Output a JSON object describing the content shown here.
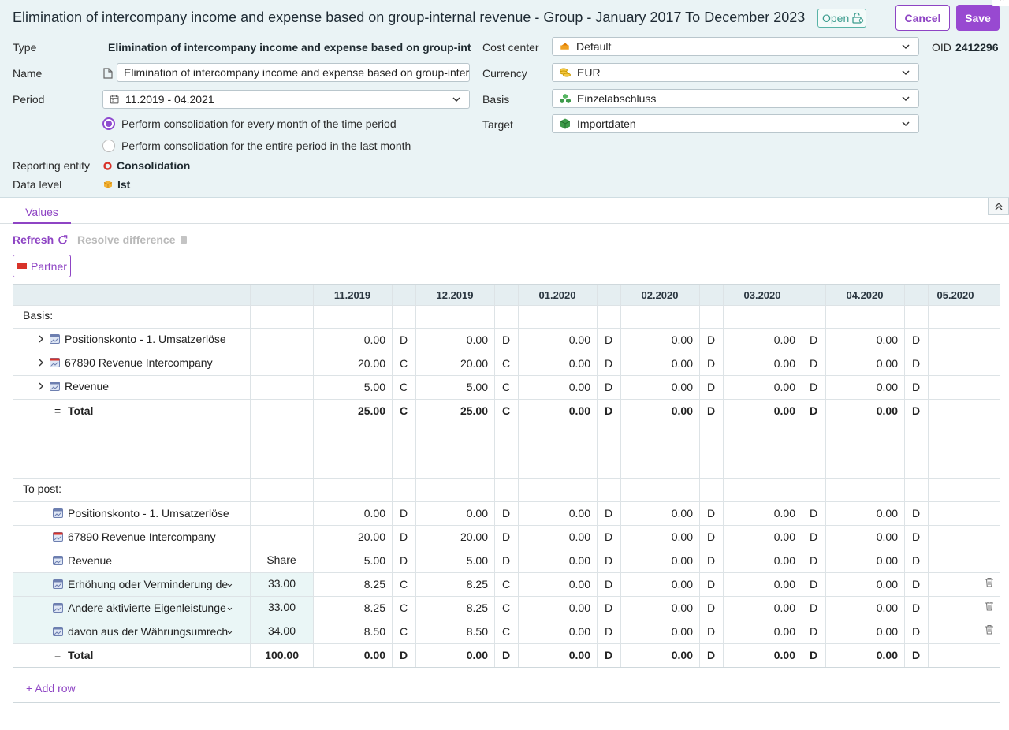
{
  "header": {
    "title": "Elimination of intercompany income and expense based on group-internal revenue - Group - January 2017 To December 2023",
    "status": "Open",
    "cancel_label": "Cancel",
    "save_label": "Save",
    "oid_label": "OID",
    "oid_value": "2412296"
  },
  "form": {
    "type_label": "Type",
    "type_value": "Elimination of intercompany income and expense based on group-inte...",
    "name_label": "Name",
    "name_value": "Elimination of intercompany income and expense based on group-internal revenue",
    "period_label": "Period",
    "period_value": "11.2019 - 04.2021",
    "radio_every_month": "Perform consolidation for every month of the time period",
    "radio_entire_period": "Perform consolidation for the entire period in the last month",
    "radio_selected": "every_month",
    "reporting_entity_label": "Reporting entity",
    "reporting_entity_value": "Consolidation",
    "data_level_label": "Data level",
    "data_level_value": "Ist",
    "cost_center_label": "Cost center",
    "cost_center_value": "Default",
    "currency_label": "Currency",
    "currency_value": "EUR",
    "basis_label": "Basis",
    "basis_value": "Einzelabschluss",
    "target_label": "Target",
    "target_value": "Importdaten"
  },
  "tabs": {
    "values_label": "Values"
  },
  "toolbar": {
    "refresh_label": "Refresh",
    "resolve_label": "Resolve difference",
    "partner_label": "Partner"
  },
  "grid": {
    "periods": [
      "11.2019",
      "12.2019",
      "01.2020",
      "02.2020",
      "03.2020",
      "04.2020",
      "05.2020"
    ],
    "basis_section": "Basis:",
    "topost_section": "To post:",
    "share_header": "Share",
    "basis_rows": [
      {
        "name": "Positionskonto - 1. Umsatzerlöse",
        "icon": "account-icon",
        "cells": [
          [
            "0.00",
            "D"
          ],
          [
            "0.00",
            "D"
          ],
          [
            "0.00",
            "D"
          ],
          [
            "0.00",
            "D"
          ],
          [
            "0.00",
            "D"
          ],
          [
            "0.00",
            "D"
          ]
        ]
      },
      {
        "name": "67890 Revenue Intercompany",
        "icon": "account-ic-icon",
        "cells": [
          [
            "20.00",
            "C"
          ],
          [
            "20.00",
            "C"
          ],
          [
            "0.00",
            "D"
          ],
          [
            "0.00",
            "D"
          ],
          [
            "0.00",
            "D"
          ],
          [
            "0.00",
            "D"
          ]
        ]
      },
      {
        "name": "Revenue",
        "icon": "account-icon",
        "cells": [
          [
            "5.00",
            "C"
          ],
          [
            "5.00",
            "C"
          ],
          [
            "0.00",
            "D"
          ],
          [
            "0.00",
            "D"
          ],
          [
            "0.00",
            "D"
          ],
          [
            "0.00",
            "D"
          ]
        ]
      }
    ],
    "basis_total": {
      "label": "Total",
      "cells": [
        [
          "25.00",
          "C"
        ],
        [
          "25.00",
          "C"
        ],
        [
          "0.00",
          "D"
        ],
        [
          "0.00",
          "D"
        ],
        [
          "0.00",
          "D"
        ],
        [
          "0.00",
          "D"
        ]
      ]
    },
    "topost_rows": [
      {
        "name": "Positionskonto - 1. Umsatzerlöse",
        "icon": "account-icon",
        "share": "",
        "cells": [
          [
            "0.00",
            "D"
          ],
          [
            "0.00",
            "D"
          ],
          [
            "0.00",
            "D"
          ],
          [
            "0.00",
            "D"
          ],
          [
            "0.00",
            "D"
          ],
          [
            "0.00",
            "D"
          ]
        ]
      },
      {
        "name": "67890 Revenue Intercompany",
        "icon": "account-ic-icon",
        "share": "",
        "cells": [
          [
            "20.00",
            "D"
          ],
          [
            "20.00",
            "D"
          ],
          [
            "0.00",
            "D"
          ],
          [
            "0.00",
            "D"
          ],
          [
            "0.00",
            "D"
          ],
          [
            "0.00",
            "D"
          ]
        ]
      },
      {
        "name": "Revenue",
        "icon": "account-icon",
        "share": "Share",
        "cells": [
          [
            "5.00",
            "D"
          ],
          [
            "5.00",
            "D"
          ],
          [
            "0.00",
            "D"
          ],
          [
            "0.00",
            "D"
          ],
          [
            "0.00",
            "D"
          ],
          [
            "0.00",
            "D"
          ]
        ]
      },
      {
        "name": "Erhöhung oder Verminderung de",
        "icon": "account-icon",
        "share": "33.00",
        "editable": true,
        "cells": [
          [
            "8.25",
            "C"
          ],
          [
            "8.25",
            "C"
          ],
          [
            "0.00",
            "D"
          ],
          [
            "0.00",
            "D"
          ],
          [
            "0.00",
            "D"
          ],
          [
            "0.00",
            "D"
          ]
        ]
      },
      {
        "name": "Andere aktivierte Eigenleistunge",
        "icon": "account-icon",
        "share": "33.00",
        "editable": true,
        "cells": [
          [
            "8.25",
            "C"
          ],
          [
            "8.25",
            "C"
          ],
          [
            "0.00",
            "D"
          ],
          [
            "0.00",
            "D"
          ],
          [
            "0.00",
            "D"
          ],
          [
            "0.00",
            "D"
          ]
        ]
      },
      {
        "name": "davon aus der Währungsumrech",
        "icon": "account-icon",
        "share": "34.00",
        "editable": true,
        "cells": [
          [
            "8.50",
            "C"
          ],
          [
            "8.50",
            "C"
          ],
          [
            "0.00",
            "D"
          ],
          [
            "0.00",
            "D"
          ],
          [
            "0.00",
            "D"
          ],
          [
            "0.00",
            "D"
          ]
        ]
      }
    ],
    "topost_total": {
      "label": "Total",
      "share": "100.00",
      "cells": [
        [
          "0.00",
          "D"
        ],
        [
          "0.00",
          "D"
        ],
        [
          "0.00",
          "D"
        ],
        [
          "0.00",
          "D"
        ],
        [
          "0.00",
          "D"
        ],
        [
          "0.00",
          "D"
        ]
      ]
    }
  },
  "footer": {
    "add_row_label": "+ Add row"
  },
  "colors": {
    "accent": "#8e44c4",
    "header_bg": "#eaf3f5",
    "teal": "#3c9c8e"
  }
}
